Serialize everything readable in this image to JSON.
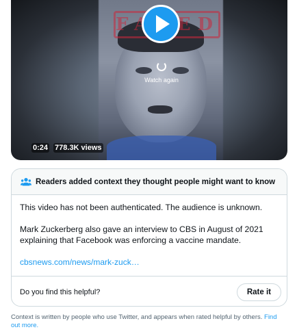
{
  "video": {
    "stamp_text": "FAKED",
    "watch_again_label": "Watch again",
    "duration": "0:24",
    "views": "778.3K views"
  },
  "note": {
    "header_icon": "people-icon",
    "title": "Readers added context they thought people might want to know",
    "paragraph_1": "This video has not been authenticated. The audience is unknown.",
    "paragraph_2": "Mark Zuckerberg also gave an interview to CBS in August of 2021 explaining that Facebook was enforcing a vaccine mandate.",
    "link_text": "cbsnews.com/news/mark-zuck…",
    "helpful_question": "Do you find this helpful?",
    "rate_button_label": "Rate it"
  },
  "footnote": {
    "text": "Context is written by people who use Twitter, and appears when rated helpful by others.",
    "link_text": "Find out more."
  },
  "colors": {
    "accent": "#1d9bf0",
    "border": "#cfd9de",
    "muted_text": "#536471"
  }
}
